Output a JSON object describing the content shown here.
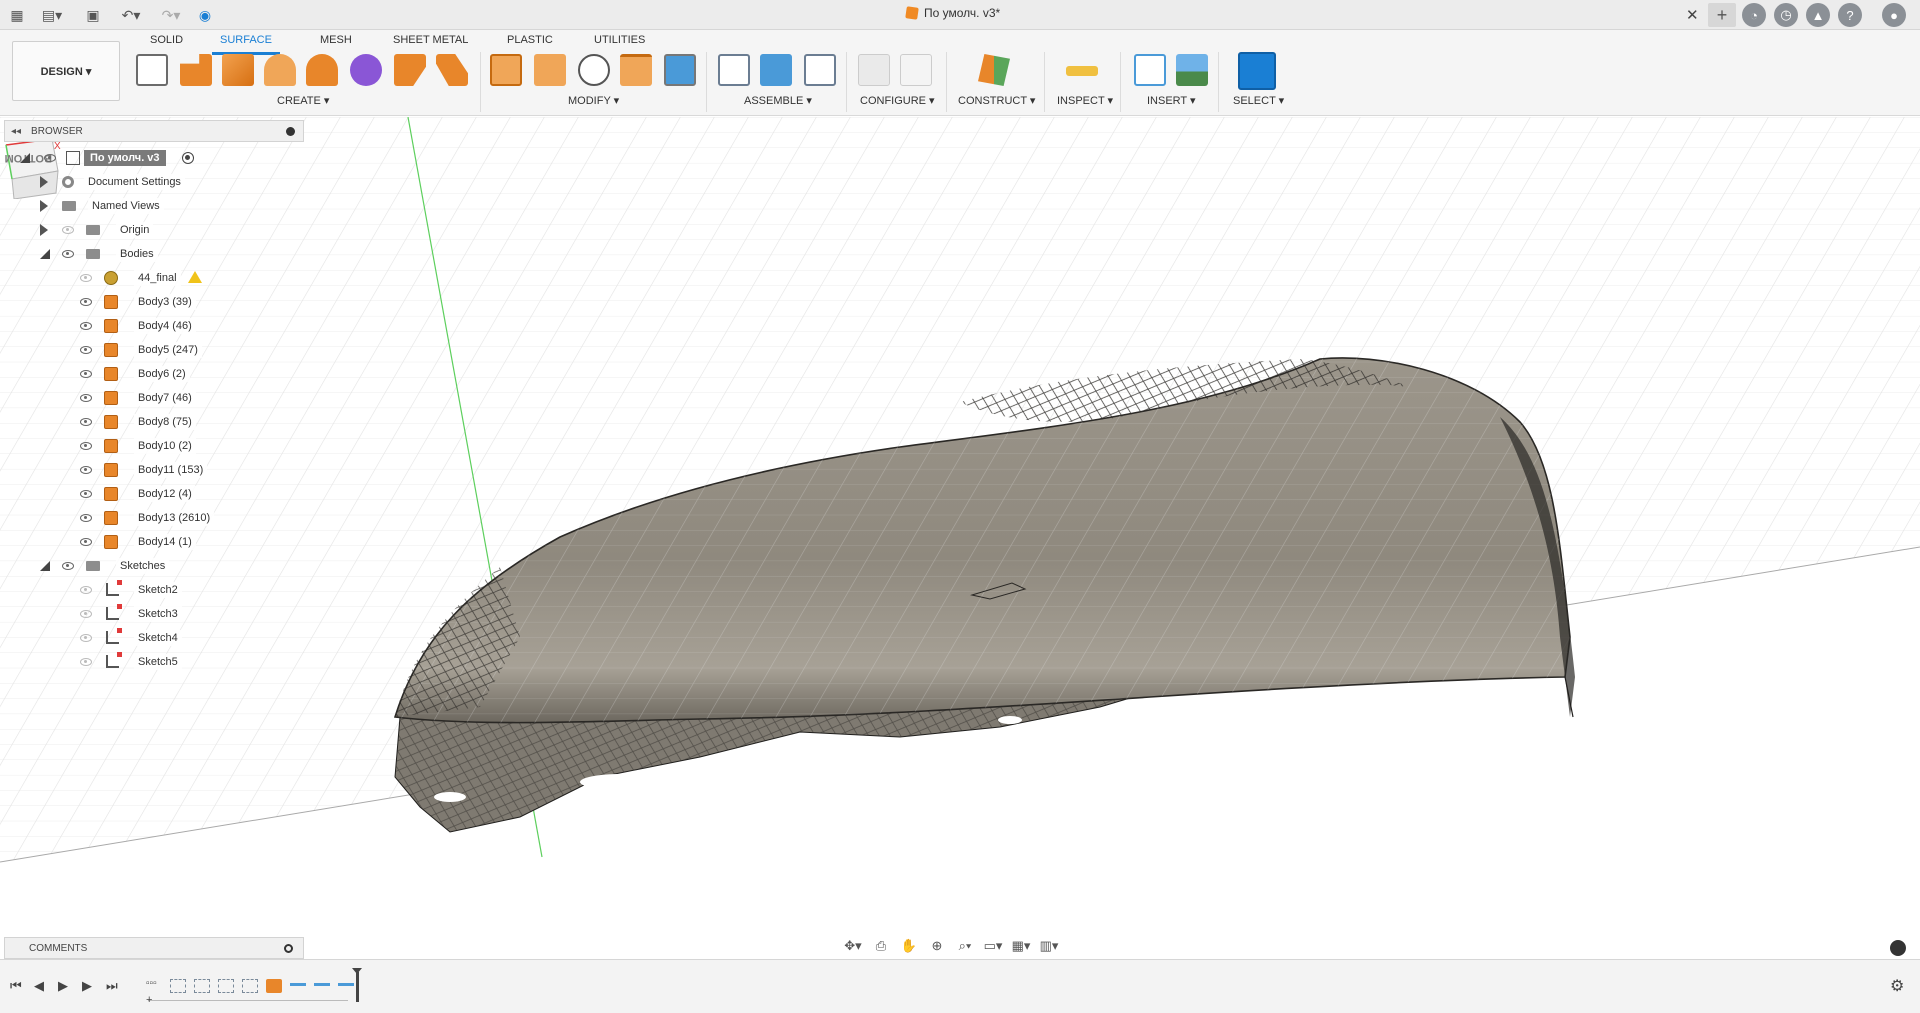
{
  "document": {
    "title": "По умолч. v3*"
  },
  "ribbon": {
    "workspace_button": "DESIGN ▾",
    "tabs": [
      {
        "label": "SOLID",
        "active": false
      },
      {
        "label": "SURFACE",
        "active": true
      },
      {
        "label": "MESH",
        "active": false
      },
      {
        "label": "SHEET METAL",
        "active": false
      },
      {
        "label": "PLASTIC",
        "active": false
      },
      {
        "label": "UTILITIES",
        "active": false
      }
    ],
    "groups": [
      "CREATE ▾",
      "MODIFY ▾",
      "ASSEMBLE ▾",
      "CONFIGURE ▾",
      "CONSTRUCT ▾",
      "INSPECT ▾",
      "INSERT ▾",
      "SELECT ▾"
    ]
  },
  "browser": {
    "title": "BROWSER",
    "root": "По умолч. v3",
    "items": [
      {
        "label": "Document Settings"
      },
      {
        "label": "Named Views"
      },
      {
        "label": "Origin"
      },
      {
        "label": "Bodies"
      },
      {
        "label": "44_final"
      },
      {
        "label": "Body3 (39)"
      },
      {
        "label": "Body4 (46)"
      },
      {
        "label": "Body5 (247)"
      },
      {
        "label": "Body6 (2)"
      },
      {
        "label": "Body7 (46)"
      },
      {
        "label": "Body8 (75)"
      },
      {
        "label": "Body10 (2)"
      },
      {
        "label": "Body11 (153)"
      },
      {
        "label": "Body12 (4)"
      },
      {
        "label": "Body13 (2610)"
      },
      {
        "label": "Body14 (1)"
      },
      {
        "label": "Sketches"
      },
      {
        "label": "Sketch2"
      },
      {
        "label": "Sketch3"
      },
      {
        "label": "Sketch4"
      },
      {
        "label": "Sketch5"
      }
    ]
  },
  "comments": {
    "title": "COMMENTS"
  },
  "viewcube": {
    "face_label": "BOTTOM",
    "axis_label": "X"
  },
  "colors": {
    "accent": "#1a7fd4",
    "body": "#e8862a",
    "mesh_surface": "#8f8a80"
  },
  "icons": [
    "grid-menu-icon",
    "file-icon",
    "save-icon",
    "undo-icon",
    "redo-icon",
    "orbit-icon",
    "pan-icon",
    "zoom-icon",
    "display-settings-icon",
    "grid-icon",
    "settings-icon"
  ]
}
